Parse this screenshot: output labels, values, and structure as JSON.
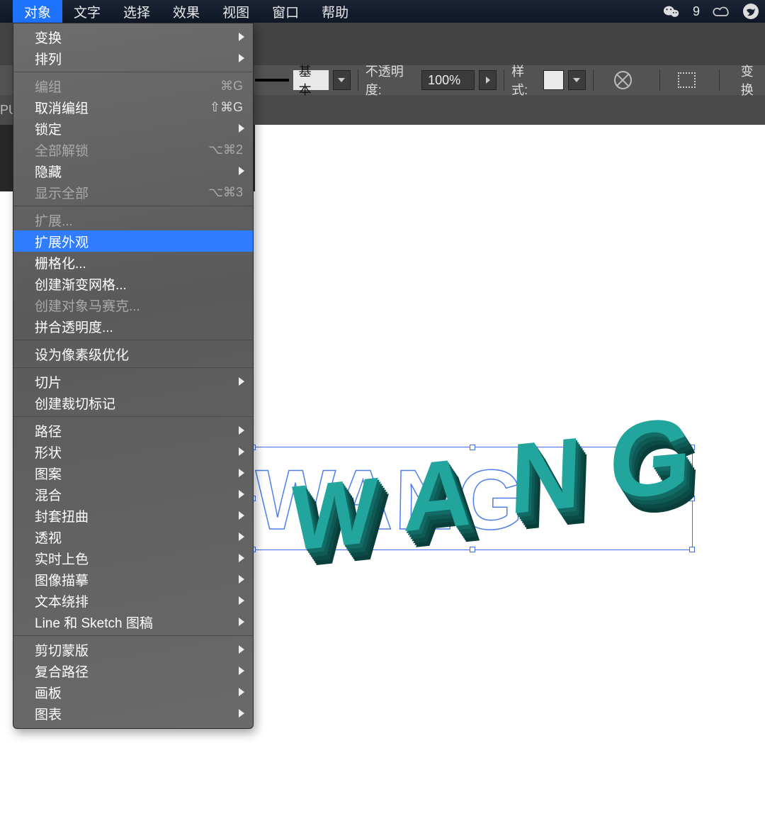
{
  "menubar": {
    "items": [
      "对象",
      "文字",
      "选择",
      "效果",
      "视图",
      "窗口",
      "帮助"
    ],
    "active_index": 0,
    "status_badge": "9"
  },
  "options_bar": {
    "stroke_preset": "基本",
    "opacity_label": "不透明度:",
    "opacity_value": "100%",
    "style_label": "样式:",
    "transform_label": "变换"
  },
  "side_label": "PU",
  "menu": {
    "groups": [
      [
        {
          "label": "变换",
          "submenu": true
        },
        {
          "label": "排列",
          "submenu": true
        }
      ],
      [
        {
          "label": "编组",
          "shortcut": "⌘G",
          "disabled": true
        },
        {
          "label": "取消编组",
          "shortcut": "⇧⌘G"
        },
        {
          "label": "锁定",
          "submenu": true
        },
        {
          "label": "全部解锁",
          "shortcut": "⌥⌘2",
          "disabled": true
        },
        {
          "label": "隐藏",
          "submenu": true
        },
        {
          "label": "显示全部",
          "shortcut": "⌥⌘3",
          "disabled": true
        }
      ],
      [
        {
          "label": "扩展...",
          "disabled": true
        },
        {
          "label": "扩展外观",
          "selected": true
        },
        {
          "label": "栅格化...",
          "disabled": false
        },
        {
          "label": "创建渐变网格..."
        },
        {
          "label": "创建对象马赛克...",
          "disabled": true
        },
        {
          "label": "拼合透明度..."
        }
      ],
      [
        {
          "label": "设为像素级优化"
        }
      ],
      [
        {
          "label": "切片",
          "submenu": true
        },
        {
          "label": "创建裁切标记"
        }
      ],
      [
        {
          "label": "路径",
          "submenu": true
        },
        {
          "label": "形状",
          "submenu": true
        },
        {
          "label": "图案",
          "submenu": true
        },
        {
          "label": "混合",
          "submenu": true
        },
        {
          "label": "封套扭曲",
          "submenu": true
        },
        {
          "label": "透视",
          "submenu": true
        },
        {
          "label": "实时上色",
          "submenu": true
        },
        {
          "label": "图像描摹",
          "submenu": true
        },
        {
          "label": "文本绕排",
          "submenu": true
        },
        {
          "label": "Line 和 Sketch 图稿",
          "submenu": true
        }
      ],
      [
        {
          "label": "剪切蒙版",
          "submenu": true
        },
        {
          "label": "复合路径",
          "submenu": true
        },
        {
          "label": "画板",
          "submenu": true
        },
        {
          "label": "图表",
          "submenu": true
        }
      ]
    ]
  },
  "artwork": {
    "text": "WANG",
    "chars": [
      "W",
      "A",
      "N",
      "G"
    ]
  }
}
